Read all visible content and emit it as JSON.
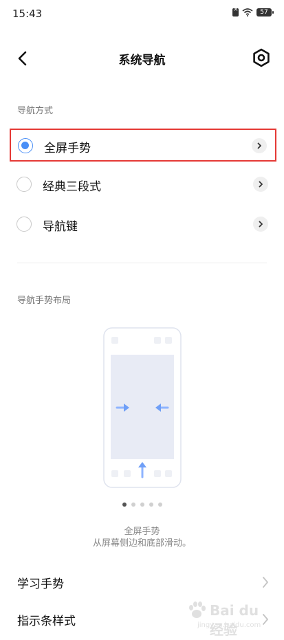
{
  "status_bar": {
    "time": "15:43",
    "battery": "57"
  },
  "header": {
    "title": "系统导航"
  },
  "nav_method": {
    "section_label": "导航方式",
    "options": [
      {
        "label": "全屏手势",
        "selected": true
      },
      {
        "label": "经典三段式",
        "selected": false
      },
      {
        "label": "导航键",
        "selected": false
      }
    ]
  },
  "gesture_layout": {
    "section_label": "导航手势布局",
    "page_count": 5,
    "active_page": 1,
    "caption_title": "全屏手势",
    "caption_desc": "从屏幕侧边和底部滑动。"
  },
  "links": [
    {
      "label": "学习手势"
    },
    {
      "label": "指示条样式"
    }
  ],
  "watermark": {
    "brand": "Bai du 经验",
    "url": "jingyan.baidu.com"
  },
  "colors": {
    "accent": "#4a8ff7",
    "highlight_border": "#e53935"
  }
}
